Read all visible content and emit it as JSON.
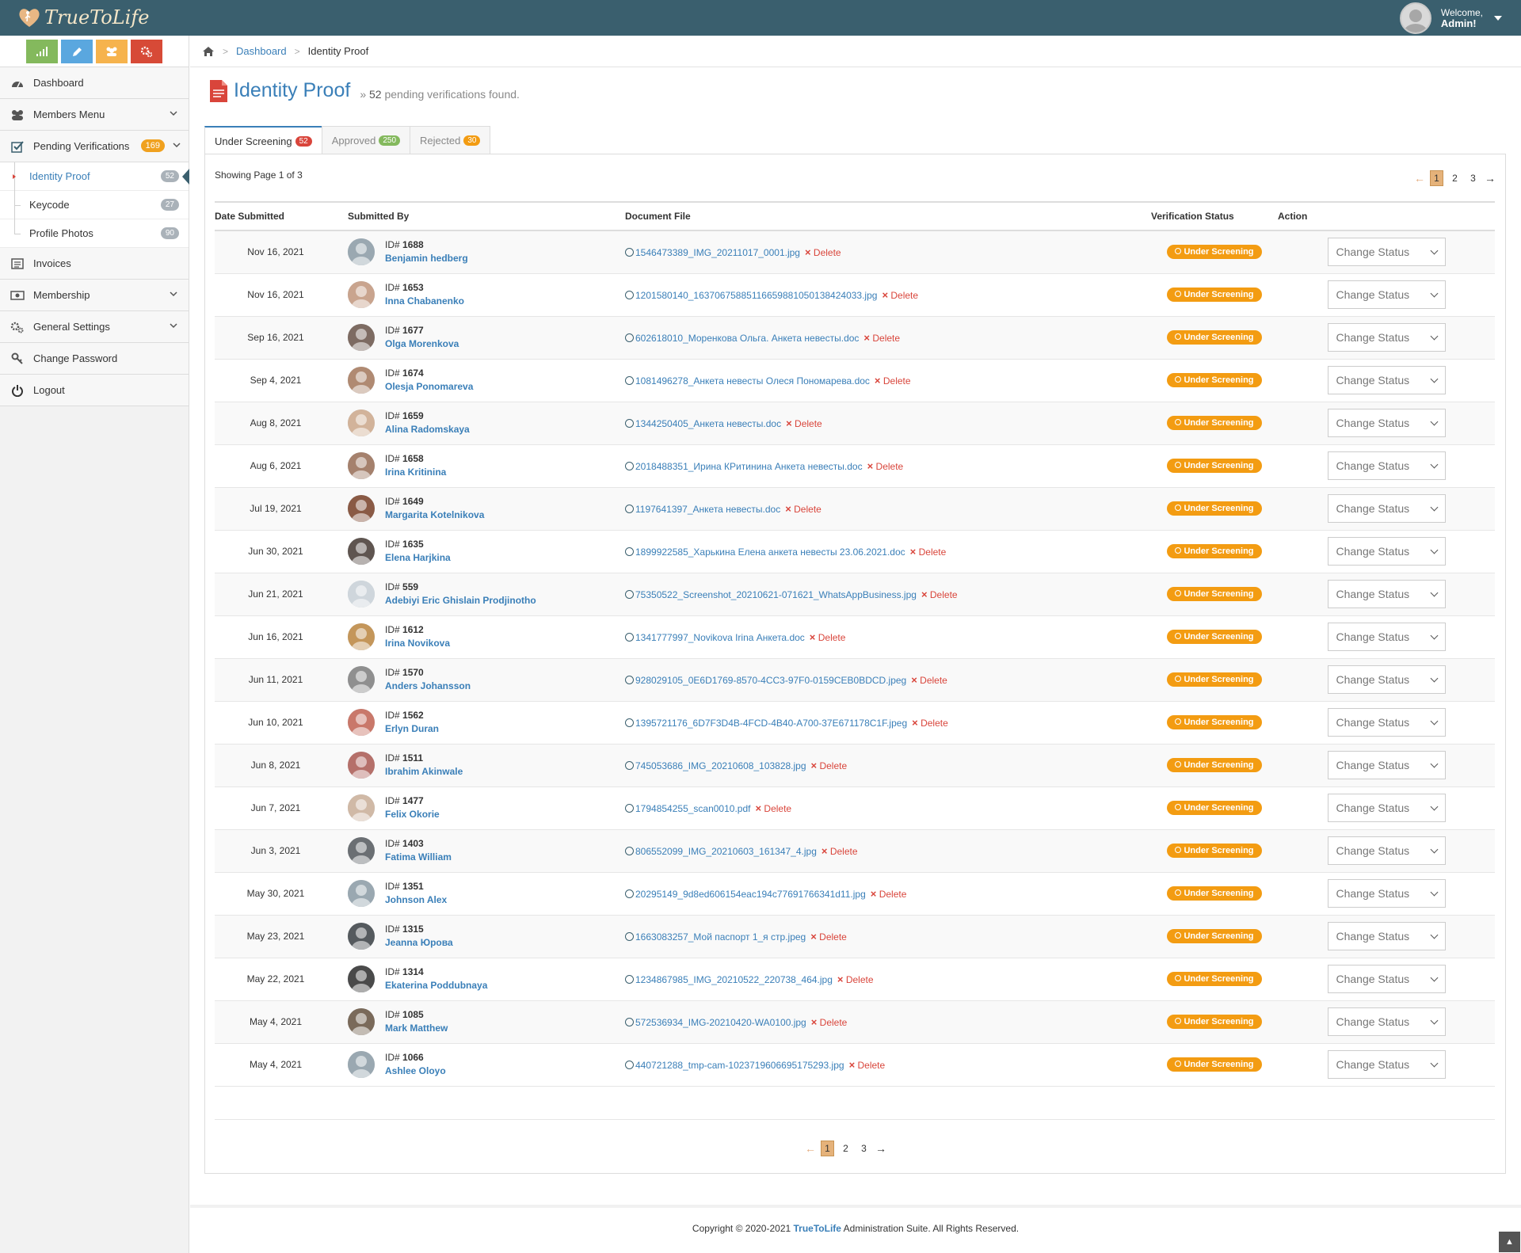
{
  "brand": {
    "name": "TrueToLife"
  },
  "user": {
    "welcome": "Welcome,",
    "name": "Admin!"
  },
  "breadcrumb": {
    "home": "home-icon",
    "dashboard": "Dashboard",
    "current": "Identity Proof"
  },
  "sidebar": {
    "shortcuts": [
      {
        "icon": "stats-icon",
        "color": "#84b95d"
      },
      {
        "icon": "pencil-icon",
        "color": "#5aa7df"
      },
      {
        "icon": "group-icon",
        "color": "#f6b34d"
      },
      {
        "icon": "cogs-icon",
        "color": "#d74a37"
      }
    ],
    "items": [
      {
        "label": "Dashboard"
      },
      {
        "label": "Members Menu"
      },
      {
        "label": "Pending Verifications",
        "badge": "169"
      },
      {
        "label": "Invoices"
      },
      {
        "label": "Membership"
      },
      {
        "label": "General Settings"
      },
      {
        "label": "Change Password"
      },
      {
        "label": "Logout"
      }
    ],
    "sub_items": [
      {
        "label": "Identity Proof",
        "badge": "52"
      },
      {
        "label": "Keycode",
        "badge": "27"
      },
      {
        "label": "Profile Photos",
        "badge": "90"
      }
    ]
  },
  "page": {
    "title": "Identity Proof",
    "subtitle_prefix": "»",
    "subtitle_count": "52",
    "subtitle_text": "pending verifications found."
  },
  "tabs": [
    {
      "label": "Under Screening",
      "count": "52",
      "color": "#d9453b"
    },
    {
      "label": "Approved",
      "count": "250",
      "color": "#84b95d"
    },
    {
      "label": "Rejected",
      "count": "30",
      "color": "#f39c12"
    }
  ],
  "listing": {
    "showing": "Showing Page 1 of 3",
    "pages": [
      "1",
      "2",
      "3"
    ],
    "prev": "←",
    "next": "→",
    "headers": {
      "date": "Date Submitted",
      "by": "Submitted By",
      "doc": "Document File",
      "status": "Verification Status",
      "action": "Action"
    },
    "id_prefix": "ID#",
    "delete_label": "Delete",
    "status_label": "Under Screening",
    "action_label": "Change Status",
    "rows": [
      {
        "date": "Nov 16, 2021",
        "id": "1688",
        "name": "Benjamin hedberg",
        "file": "1546473389_IMG_20211017_0001.jpg"
      },
      {
        "date": "Nov 16, 2021",
        "id": "1653",
        "name": "Inna Chabanenko",
        "file": "1201580140_16370675885116659881050138424033.jpg"
      },
      {
        "date": "Sep 16, 2021",
        "id": "1677",
        "name": "Olga Morenkova",
        "file": "602618010_Моренкова Ольга. Анкета невесты.doc"
      },
      {
        "date": "Sep 4, 2021",
        "id": "1674",
        "name": "Olesja Ponomareva",
        "file": "1081496278_Анкета невесты Олеся Пономарева.doc"
      },
      {
        "date": "Aug 8, 2021",
        "id": "1659",
        "name": "Alina Radomskaya",
        "file": "1344250405_Анкета невесты.doc"
      },
      {
        "date": "Aug 6, 2021",
        "id": "1658",
        "name": "Irina Kritinina",
        "file": "2018488351_Ирина КРитинина Анкета невесты.doc"
      },
      {
        "date": "Jul 19, 2021",
        "id": "1649",
        "name": "Margarita Kotelnikova",
        "file": "1197641397_Анкета невесты.doc"
      },
      {
        "date": "Jun 30, 2021",
        "id": "1635",
        "name": "Elena Harjkina",
        "file": "1899922585_Харькина Елена анкета невесты 23.06.2021.doc"
      },
      {
        "date": "Jun 21, 2021",
        "id": "559",
        "name": "Adebiyi Eric Ghislain Prodjinotho",
        "file": "75350522_Screenshot_20210621-071621_WhatsAppBusiness.jpg"
      },
      {
        "date": "Jun 16, 2021",
        "id": "1612",
        "name": "Irina Novikova",
        "file": "1341777997_Novikova Irina Анкета.doc"
      },
      {
        "date": "Jun 11, 2021",
        "id": "1570",
        "name": "Anders Johansson",
        "file": "928029105_0E6D1769-8570-4CC3-97F0-0159CEB0BDCD.jpeg"
      },
      {
        "date": "Jun 10, 2021",
        "id": "1562",
        "name": "Erlyn Duran",
        "file": "1395721176_6D7F3D4B-4FCD-4B40-A700-37E671178C1F.jpeg"
      },
      {
        "date": "Jun 8, 2021",
        "id": "1511",
        "name": "Ibrahim Akinwale",
        "file": "745053686_IMG_20210608_103828.jpg"
      },
      {
        "date": "Jun 7, 2021",
        "id": "1477",
        "name": "Felix Okorie",
        "file": "1794854255_scan0010.pdf"
      },
      {
        "date": "Jun 3, 2021",
        "id": "1403",
        "name": "Fatima William",
        "file": "806552099_IMG_20210603_161347_4.jpg"
      },
      {
        "date": "May 30, 2021",
        "id": "1351",
        "name": "Johnson Alex",
        "file": "20295149_9d8ed606154eac194c77691766341d11.jpg"
      },
      {
        "date": "May 23, 2021",
        "id": "1315",
        "name": "Jeanna Юрова",
        "file": "1663083257_Мой паспорт 1_я стр.jpeg"
      },
      {
        "date": "May 22, 2021",
        "id": "1314",
        "name": "Ekaterina Poddubnaya",
        "file": "1234867985_IMG_20210522_220738_464.jpg"
      },
      {
        "date": "May 4, 2021",
        "id": "1085",
        "name": "Mark Matthew",
        "file": "572536934_IMG-20210420-WA0100.jpg"
      },
      {
        "date": "May 4, 2021",
        "id": "1066",
        "name": "Ashlee Oloyo",
        "file": "440721288_tmp-cam-1023719606695175293.jpg"
      }
    ]
  },
  "footer": {
    "prefix": "Copyright © 2020-2021",
    "brand": "TrueToLife",
    "suffix": "Administration Suite. All Rights Reserved."
  },
  "colors": {
    "topbar": "#3a5f6e",
    "accent": "#3a7fb8",
    "warning": "#f39c12",
    "danger": "#d9453b"
  }
}
